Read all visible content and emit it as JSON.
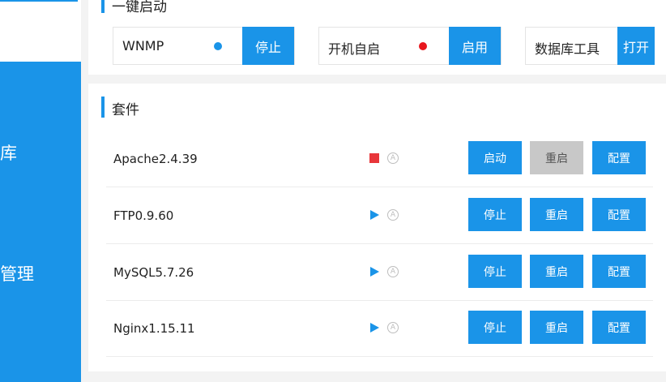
{
  "sidebar": {
    "items": [
      {
        "label": "库"
      },
      {
        "label": "管理"
      }
    ]
  },
  "quick": {
    "title": "一键启动",
    "boxes": [
      {
        "label": "WNMP",
        "dot_color": "#1a94e8",
        "button": "停止"
      },
      {
        "label": "开机自启",
        "dot_color": "#e8161d",
        "button": "启用"
      },
      {
        "label": "数据库工具",
        "button": "打开"
      }
    ]
  },
  "suite": {
    "title": "套件",
    "rows": [
      {
        "name": "Apache2.4.39",
        "status_icon": "stop-square-icon",
        "status_color": "#e8363a",
        "auto_glyph": "A",
        "buttons": [
          {
            "label": "启动",
            "enabled": true
          },
          {
            "label": "重启",
            "enabled": false
          },
          {
            "label": "配置",
            "enabled": true
          }
        ]
      },
      {
        "name": "FTP0.9.60",
        "status_icon": "play-triangle-icon",
        "status_color": "#1a94e8",
        "auto_glyph": "A",
        "buttons": [
          {
            "label": "停止",
            "enabled": true
          },
          {
            "label": "重启",
            "enabled": true
          },
          {
            "label": "配置",
            "enabled": true
          }
        ]
      },
      {
        "name": "MySQL5.7.26",
        "status_icon": "play-triangle-icon",
        "status_color": "#1a94e8",
        "auto_glyph": "A",
        "buttons": [
          {
            "label": "停止",
            "enabled": true
          },
          {
            "label": "重启",
            "enabled": true
          },
          {
            "label": "配置",
            "enabled": true
          }
        ]
      },
      {
        "name": "Nginx1.15.11",
        "status_icon": "play-triangle-icon",
        "status_color": "#1a94e8",
        "auto_glyph": "A",
        "buttons": [
          {
            "label": "停止",
            "enabled": true
          },
          {
            "label": "重启",
            "enabled": true
          },
          {
            "label": "配置",
            "enabled": true
          }
        ]
      }
    ]
  },
  "colors": {
    "accent": "#1a94e8",
    "disabled": "#c8c8c8"
  }
}
